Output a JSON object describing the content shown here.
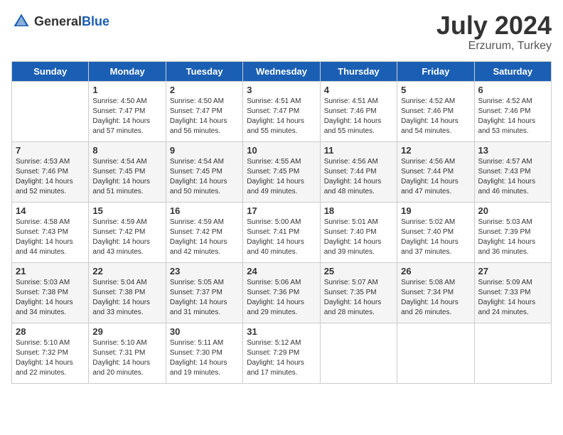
{
  "header": {
    "logo_general": "General",
    "logo_blue": "Blue",
    "month_year": "July 2024",
    "location": "Erzurum, Turkey"
  },
  "weekdays": [
    "Sunday",
    "Monday",
    "Tuesday",
    "Wednesday",
    "Thursday",
    "Friday",
    "Saturday"
  ],
  "weeks": [
    [
      {
        "day": "",
        "sunrise": "",
        "sunset": "",
        "daylight": ""
      },
      {
        "day": "1",
        "sunrise": "Sunrise: 4:50 AM",
        "sunset": "Sunset: 7:47 PM",
        "daylight": "Daylight: 14 hours and 57 minutes."
      },
      {
        "day": "2",
        "sunrise": "Sunrise: 4:50 AM",
        "sunset": "Sunset: 7:47 PM",
        "daylight": "Daylight: 14 hours and 56 minutes."
      },
      {
        "day": "3",
        "sunrise": "Sunrise: 4:51 AM",
        "sunset": "Sunset: 7:47 PM",
        "daylight": "Daylight: 14 hours and 55 minutes."
      },
      {
        "day": "4",
        "sunrise": "Sunrise: 4:51 AM",
        "sunset": "Sunset: 7:46 PM",
        "daylight": "Daylight: 14 hours and 55 minutes."
      },
      {
        "day": "5",
        "sunrise": "Sunrise: 4:52 AM",
        "sunset": "Sunset: 7:46 PM",
        "daylight": "Daylight: 14 hours and 54 minutes."
      },
      {
        "day": "6",
        "sunrise": "Sunrise: 4:52 AM",
        "sunset": "Sunset: 7:46 PM",
        "daylight": "Daylight: 14 hours and 53 minutes."
      }
    ],
    [
      {
        "day": "7",
        "sunrise": "Sunrise: 4:53 AM",
        "sunset": "Sunset: 7:46 PM",
        "daylight": "Daylight: 14 hours and 52 minutes."
      },
      {
        "day": "8",
        "sunrise": "Sunrise: 4:54 AM",
        "sunset": "Sunset: 7:45 PM",
        "daylight": "Daylight: 14 hours and 51 minutes."
      },
      {
        "day": "9",
        "sunrise": "Sunrise: 4:54 AM",
        "sunset": "Sunset: 7:45 PM",
        "daylight": "Daylight: 14 hours and 50 minutes."
      },
      {
        "day": "10",
        "sunrise": "Sunrise: 4:55 AM",
        "sunset": "Sunset: 7:45 PM",
        "daylight": "Daylight: 14 hours and 49 minutes."
      },
      {
        "day": "11",
        "sunrise": "Sunrise: 4:56 AM",
        "sunset": "Sunset: 7:44 PM",
        "daylight": "Daylight: 14 hours and 48 minutes."
      },
      {
        "day": "12",
        "sunrise": "Sunrise: 4:56 AM",
        "sunset": "Sunset: 7:44 PM",
        "daylight": "Daylight: 14 hours and 47 minutes."
      },
      {
        "day": "13",
        "sunrise": "Sunrise: 4:57 AM",
        "sunset": "Sunset: 7:43 PM",
        "daylight": "Daylight: 14 hours and 46 minutes."
      }
    ],
    [
      {
        "day": "14",
        "sunrise": "Sunrise: 4:58 AM",
        "sunset": "Sunset: 7:43 PM",
        "daylight": "Daylight: 14 hours and 44 minutes."
      },
      {
        "day": "15",
        "sunrise": "Sunrise: 4:59 AM",
        "sunset": "Sunset: 7:42 PM",
        "daylight": "Daylight: 14 hours and 43 minutes."
      },
      {
        "day": "16",
        "sunrise": "Sunrise: 4:59 AM",
        "sunset": "Sunset: 7:42 PM",
        "daylight": "Daylight: 14 hours and 42 minutes."
      },
      {
        "day": "17",
        "sunrise": "Sunrise: 5:00 AM",
        "sunset": "Sunset: 7:41 PM",
        "daylight": "Daylight: 14 hours and 40 minutes."
      },
      {
        "day": "18",
        "sunrise": "Sunrise: 5:01 AM",
        "sunset": "Sunset: 7:40 PM",
        "daylight": "Daylight: 14 hours and 39 minutes."
      },
      {
        "day": "19",
        "sunrise": "Sunrise: 5:02 AM",
        "sunset": "Sunset: 7:40 PM",
        "daylight": "Daylight: 14 hours and 37 minutes."
      },
      {
        "day": "20",
        "sunrise": "Sunrise: 5:03 AM",
        "sunset": "Sunset: 7:39 PM",
        "daylight": "Daylight: 14 hours and 36 minutes."
      }
    ],
    [
      {
        "day": "21",
        "sunrise": "Sunrise: 5:03 AM",
        "sunset": "Sunset: 7:38 PM",
        "daylight": "Daylight: 14 hours and 34 minutes."
      },
      {
        "day": "22",
        "sunrise": "Sunrise: 5:04 AM",
        "sunset": "Sunset: 7:38 PM",
        "daylight": "Daylight: 14 hours and 33 minutes."
      },
      {
        "day": "23",
        "sunrise": "Sunrise: 5:05 AM",
        "sunset": "Sunset: 7:37 PM",
        "daylight": "Daylight: 14 hours and 31 minutes."
      },
      {
        "day": "24",
        "sunrise": "Sunrise: 5:06 AM",
        "sunset": "Sunset: 7:36 PM",
        "daylight": "Daylight: 14 hours and 29 minutes."
      },
      {
        "day": "25",
        "sunrise": "Sunrise: 5:07 AM",
        "sunset": "Sunset: 7:35 PM",
        "daylight": "Daylight: 14 hours and 28 minutes."
      },
      {
        "day": "26",
        "sunrise": "Sunrise: 5:08 AM",
        "sunset": "Sunset: 7:34 PM",
        "daylight": "Daylight: 14 hours and 26 minutes."
      },
      {
        "day": "27",
        "sunrise": "Sunrise: 5:09 AM",
        "sunset": "Sunset: 7:33 PM",
        "daylight": "Daylight: 14 hours and 24 minutes."
      }
    ],
    [
      {
        "day": "28",
        "sunrise": "Sunrise: 5:10 AM",
        "sunset": "Sunset: 7:32 PM",
        "daylight": "Daylight: 14 hours and 22 minutes."
      },
      {
        "day": "29",
        "sunrise": "Sunrise: 5:10 AM",
        "sunset": "Sunset: 7:31 PM",
        "daylight": "Daylight: 14 hours and 20 minutes."
      },
      {
        "day": "30",
        "sunrise": "Sunrise: 5:11 AM",
        "sunset": "Sunset: 7:30 PM",
        "daylight": "Daylight: 14 hours and 19 minutes."
      },
      {
        "day": "31",
        "sunrise": "Sunrise: 5:12 AM",
        "sunset": "Sunset: 7:29 PM",
        "daylight": "Daylight: 14 hours and 17 minutes."
      },
      {
        "day": "",
        "sunrise": "",
        "sunset": "",
        "daylight": ""
      },
      {
        "day": "",
        "sunrise": "",
        "sunset": "",
        "daylight": ""
      },
      {
        "day": "",
        "sunrise": "",
        "sunset": "",
        "daylight": ""
      }
    ]
  ]
}
